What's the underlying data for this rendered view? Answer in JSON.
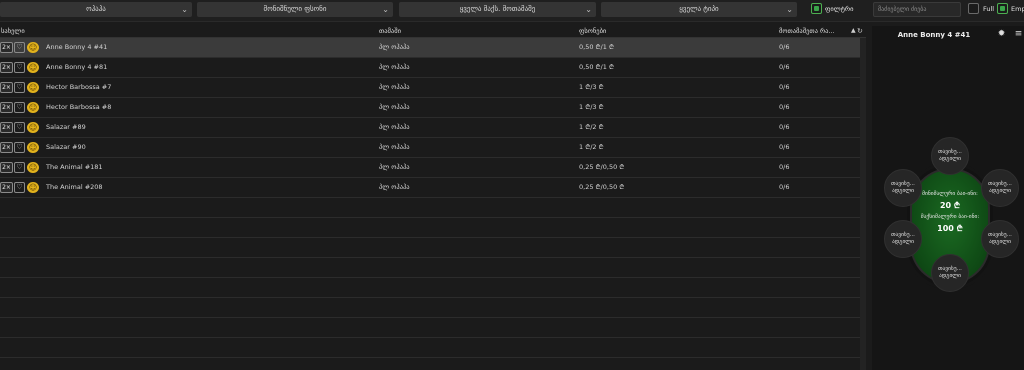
{
  "filters": {
    "dropdowns": [
      {
        "value": "ოჰაჰა"
      },
      {
        "value": "მონიშნული ფსონი"
      },
      {
        "value": "ყველა მაქს. მოთამაშე"
      },
      {
        "value": "ყველა ტიპი"
      }
    ],
    "filter_checkbox_label": "ფილტრი",
    "search_placeholder": "მაძიებელი ძიება",
    "full_label": "Full",
    "empty_label": "Emp"
  },
  "table": {
    "columns": [
      "სახელი",
      "თამაში",
      "ფსონები",
      "მოთამაშეთა რა..."
    ],
    "rows": [
      {
        "badge": "2×",
        "name": "Anne Bonny 4 #41",
        "game": "პლ ოჰაჰა",
        "stakes": "0,50 ₾/1 ₾",
        "players": "0/6"
      },
      {
        "badge": "2×",
        "name": "Anne Bonny 4 #81",
        "game": "პლ ოჰაჰა",
        "stakes": "0,50 ₾/1 ₾",
        "players": "0/6"
      },
      {
        "badge": "2×",
        "name": "Hector Barbossa #7",
        "game": "პლ ოჰაჰა",
        "stakes": "1 ₾/3 ₾",
        "players": "0/6"
      },
      {
        "badge": "2×",
        "name": "Hector Barbossa #8",
        "game": "პლ ოჰაჰა",
        "stakes": "1 ₾/3 ₾",
        "players": "0/6"
      },
      {
        "badge": "2×",
        "name": "Salazar #89",
        "game": "პლ ოჰაჰა",
        "stakes": "1 ₾/2 ₾",
        "players": "0/6"
      },
      {
        "badge": "2×",
        "name": "Salazar #90",
        "game": "პლ ოჰაჰა",
        "stakes": "1 ₾/2 ₾",
        "players": "0/6"
      },
      {
        "badge": "2×",
        "name": "The Animal #181",
        "game": "პლ ოჰაჰა",
        "stakes": "0,25 ₾/0,50 ₾",
        "players": "0/6"
      },
      {
        "badge": "2×",
        "name": "The Animal #208",
        "game": "პლ ოჰაჰა",
        "stakes": "0,25 ₾/0,50 ₾",
        "players": "0/6"
      }
    ]
  },
  "preview": {
    "title": "Anne Bonny 4 #41",
    "min_buyin_label": "მინიმალური ბაი-ინი:",
    "min_buyin_value": "20 ₾",
    "max_buyin_label": "მაქსიმალური ბაი-ინი:",
    "max_buyin_value": "100 ₾",
    "seat_line1": "თავისუ...",
    "seat_line2": "ადგილი"
  },
  "colors": {
    "accent": "#3aa54a",
    "felt": "#135a1b",
    "selected_row": "#3b3b3b"
  },
  "icons": {
    "dropdown": "chevron-down-icon",
    "shield": "shield-icon",
    "smile": "smiley-icon",
    "settings": "gear-icon",
    "menu": "menu-icon",
    "sort": "sort-up-icon",
    "refresh": "refresh-icon"
  }
}
